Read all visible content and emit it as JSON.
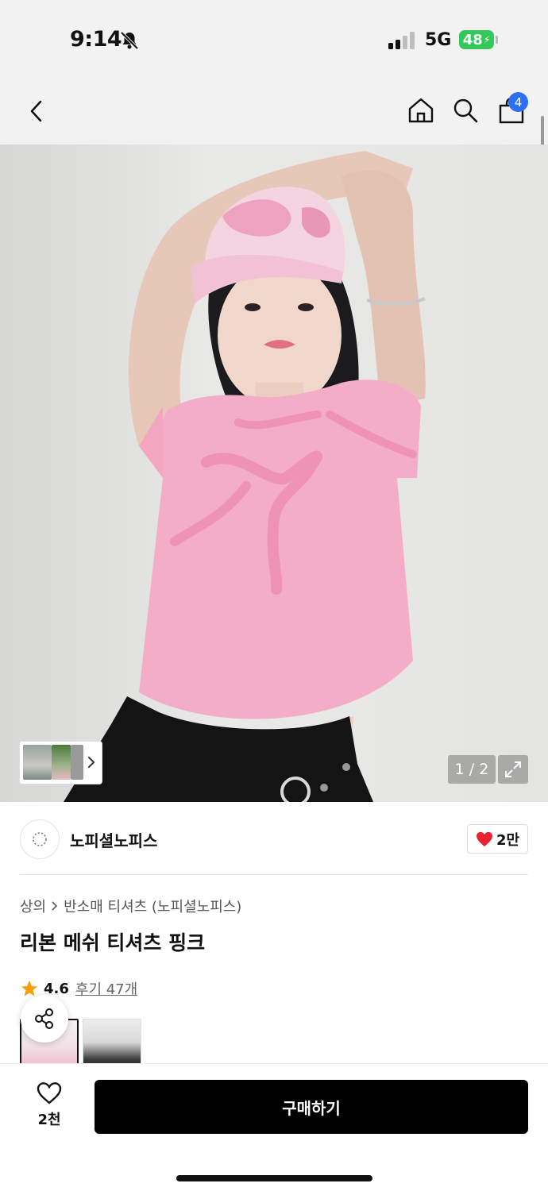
{
  "status_bar": {
    "time": "9:14",
    "network": "5G",
    "battery": "48"
  },
  "nav": {
    "cart_count": "4",
    "icons": [
      "chevron-left-icon",
      "home-icon",
      "search-icon",
      "shopping-bag-icon"
    ]
  },
  "gallery": {
    "counter": "1 / 2",
    "current_index": 1,
    "total": 2
  },
  "store": {
    "name": "노피셜노피스",
    "like_count": "2만"
  },
  "product": {
    "breadcrumb": [
      "상의",
      "반소매 티셔츠 (노피셜노피스)"
    ],
    "title": "리본 메쉬 티셔츠 핑크",
    "rating": "4.6",
    "review_link": "후기 47개"
  },
  "bottom_bar": {
    "wish_count": "2천",
    "buy_label": "구매하기"
  },
  "colors": {
    "accent_blue": "#2b6ff5",
    "battery_green": "#34c759",
    "heart_red": "#e8232f",
    "star_orange": "#f59e0b",
    "buy_button": "#000000"
  }
}
